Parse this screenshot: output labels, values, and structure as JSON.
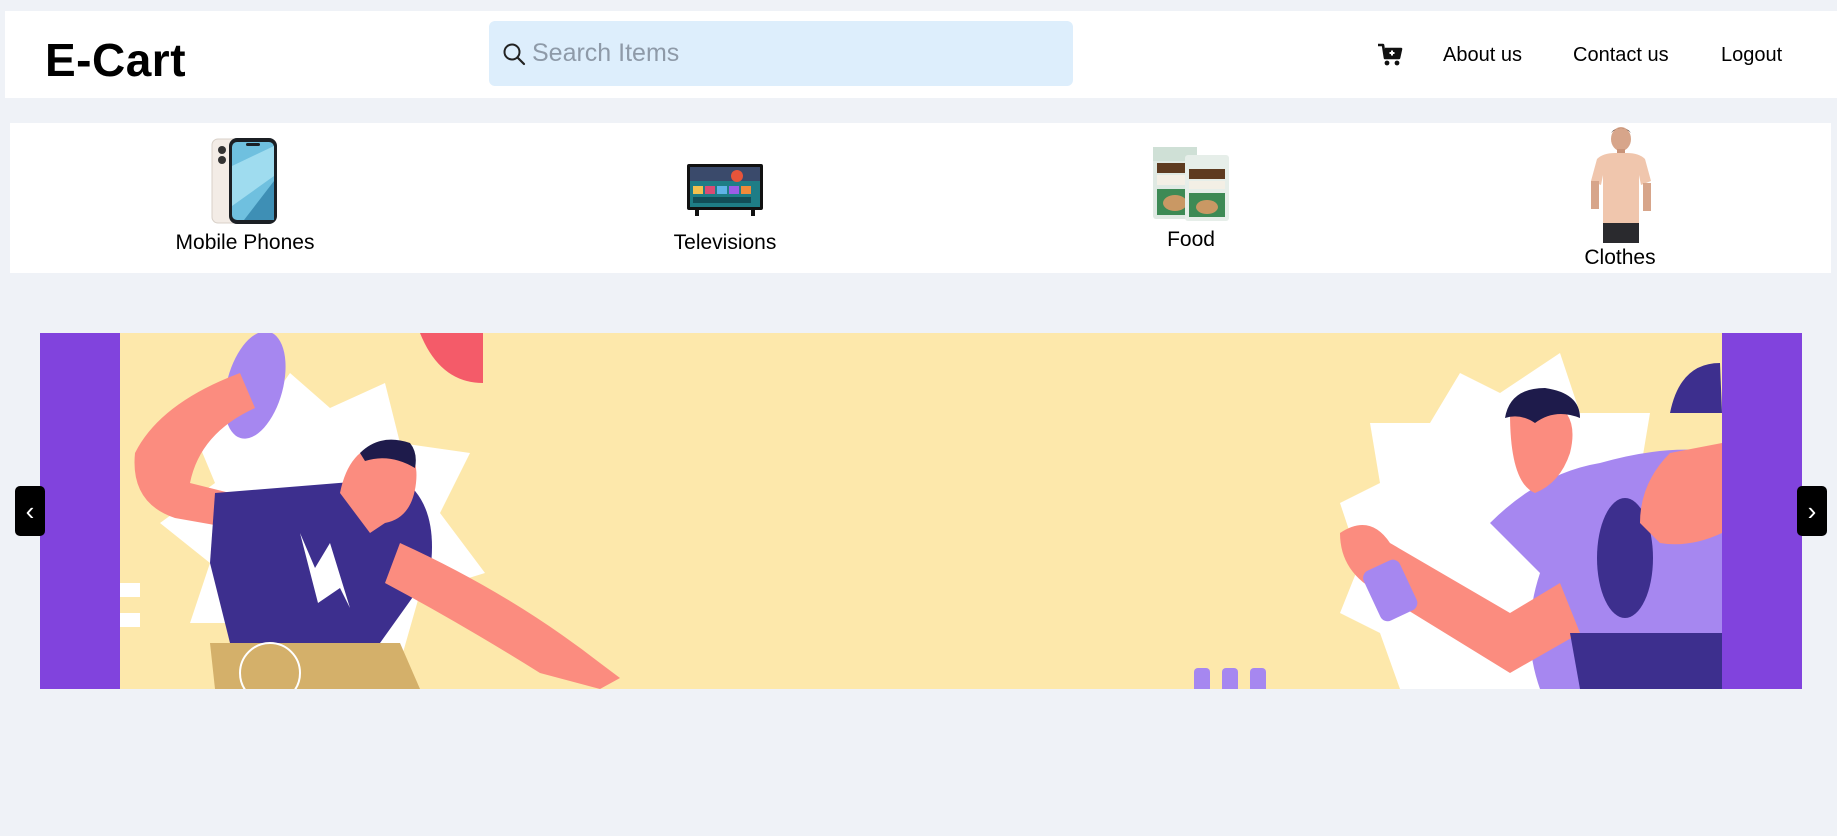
{
  "header": {
    "brand": "E-Cart",
    "search": {
      "placeholder": "Search Items",
      "value": "",
      "icon": "search-icon"
    },
    "cart_icon": "cart-icon",
    "nav": [
      {
        "label": "About us"
      },
      {
        "label": "Contact us"
      },
      {
        "label": "Logout"
      }
    ]
  },
  "categories": [
    {
      "label": "Mobile Phones",
      "icon": "mobile-phone-image"
    },
    {
      "label": "Televisions",
      "icon": "television-image"
    },
    {
      "label": "Food",
      "icon": "atta-packet-image"
    },
    {
      "label": "Clothes",
      "icon": "tshirt-model-image"
    }
  ],
  "carousel": {
    "prev_label": "‹",
    "next_label": "›",
    "banner_image": "sports-illustration-banner"
  },
  "colors": {
    "page_bg": "#eff2f7",
    "search_bg": "#ddeefc",
    "banner_bg": "#fde8ab",
    "banner_side": "#8143dd",
    "accent_purple": "#a687f0"
  }
}
